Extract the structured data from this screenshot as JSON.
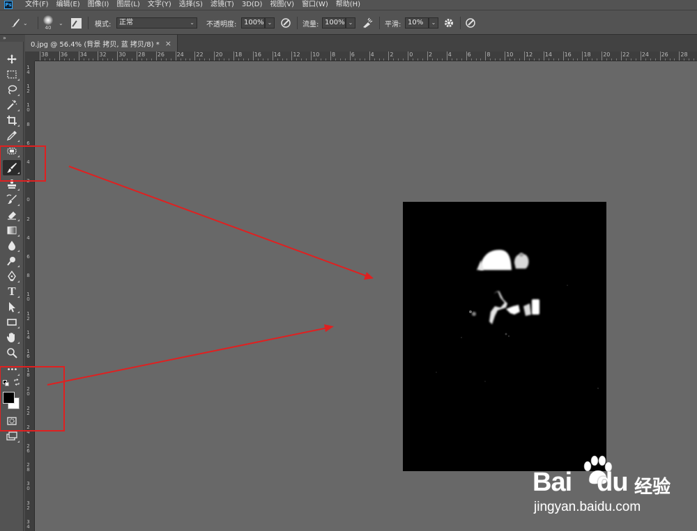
{
  "app": {
    "logo_text": "Ps"
  },
  "menu": [
    "文件(F)",
    "编辑(E)",
    "图像(I)",
    "图层(L)",
    "文字(Y)",
    "选择(S)",
    "滤镜(T)",
    "3D(D)",
    "视图(V)",
    "窗口(W)",
    "帮助(H)"
  ],
  "options_bar": {
    "brush_size": "40",
    "mode_label": "模式:",
    "mode_value": "正常",
    "opacity_label": "不透明度:",
    "opacity_value": "100%",
    "flow_label": "流量:",
    "flow_value": "100%",
    "smoothing_label": "平滑:",
    "smoothing_value": "10%"
  },
  "collapse_arrows": "»",
  "document": {
    "tab_title": "0.jpg @ 56.4% (背景 拷贝, 蓝 拷贝/8) *",
    "close_glyph": "×"
  },
  "ruler_top": [
    "38",
    "36",
    "34",
    "32",
    "30",
    "28",
    "26",
    "24",
    "22",
    "20",
    "18",
    "16",
    "14",
    "12",
    "10",
    "8",
    "6",
    "4",
    "2",
    "0",
    "2",
    "4",
    "6",
    "8",
    "10",
    "12",
    "14",
    "16",
    "18",
    "20",
    "22",
    "24",
    "26",
    "28"
  ],
  "ruler_left": [
    "14",
    "12",
    "10",
    "8",
    "6",
    "4",
    "2",
    "0",
    "2",
    "4",
    "6",
    "8",
    "10",
    "12",
    "14",
    "16",
    "18",
    "20",
    "22",
    "24",
    "26",
    "28",
    "30",
    "32",
    "34",
    "36"
  ],
  "tools": [
    {
      "name": "move-tool-icon",
      "active": false
    },
    {
      "name": "marquee-tool-icon",
      "active": false
    },
    {
      "name": "lasso-tool-icon",
      "active": false
    },
    {
      "name": "magic-wand-tool-icon",
      "active": false
    },
    {
      "name": "crop-tool-icon",
      "active": false
    },
    {
      "name": "eyedropper-tool-icon",
      "active": false
    },
    {
      "name": "healing-brush-tool-icon",
      "active": false
    },
    {
      "name": "brush-tool-icon",
      "active": true
    },
    {
      "name": "clone-stamp-tool-icon",
      "active": false
    },
    {
      "name": "history-brush-tool-icon",
      "active": false
    },
    {
      "name": "eraser-tool-icon",
      "active": false
    },
    {
      "name": "gradient-tool-icon",
      "active": false
    },
    {
      "name": "blur-tool-icon",
      "active": false
    },
    {
      "name": "dodge-tool-icon",
      "active": false
    },
    {
      "name": "pen-tool-icon",
      "active": false
    },
    {
      "name": "type-tool-icon",
      "active": false
    },
    {
      "name": "path-selection-tool-icon",
      "active": false
    },
    {
      "name": "rectangle-tool-icon",
      "active": false
    },
    {
      "name": "hand-tool-icon",
      "active": false
    },
    {
      "name": "zoom-tool-icon",
      "active": false
    },
    {
      "name": "more-tools-icon",
      "active": false
    }
  ],
  "type_tool_glyph": "T",
  "more_tools_glyph": "•••",
  "colors": {
    "foreground": "#000000",
    "background": "#ffffff",
    "annotation_red": "#e02020",
    "canvas_bg": "#686868"
  },
  "watermark": {
    "logo": "Bai",
    "logo_paw": "du",
    "brand": "经验",
    "url": "jingyan.baidu.com"
  }
}
